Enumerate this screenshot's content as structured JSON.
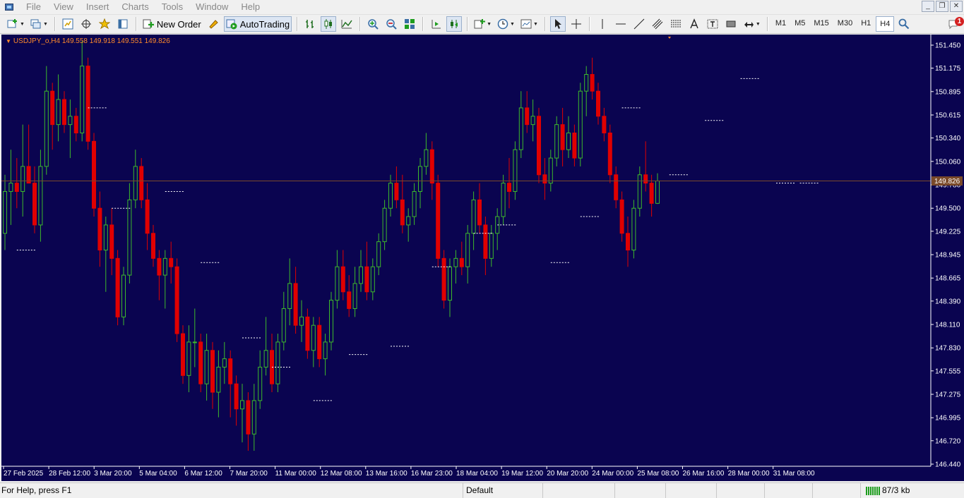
{
  "menubar": {
    "items": [
      "File",
      "View",
      "Insert",
      "Charts",
      "Tools",
      "Window",
      "Help"
    ]
  },
  "toolbar": {
    "new_order_label": "New Order",
    "autotrading_label": "AutoTrading",
    "timeframes": [
      "M1",
      "M5",
      "M15",
      "M30",
      "H1",
      "H4"
    ],
    "active_timeframe": "H4",
    "notifications_count": "1"
  },
  "chart": {
    "symbol_header": "USDJPY_o,H4  149.558 149.918 149.551 149.826",
    "background": "#0a0450",
    "bull_color": "#3dba2b",
    "bear_color": "#e00000",
    "current_price_label": "149.826",
    "current_price": 149.826,
    "price_scale": [
      "151.450",
      "151.175",
      "150.895",
      "150.615",
      "150.340",
      "150.060",
      "149.780",
      "149.500",
      "149.225",
      "148.945",
      "148.665",
      "148.390",
      "148.110",
      "147.830",
      "147.555",
      "147.275",
      "146.995",
      "146.720",
      "146.440"
    ],
    "time_scale": [
      "27 Feb 2025",
      "28 Feb 12:00",
      "3 Mar 20:00",
      "5 Mar 04:00",
      "6 Mar 12:00",
      "7 Mar 20:00",
      "11 Mar 00:00",
      "12 Mar 08:00",
      "13 Mar 16:00",
      "16 Mar 23:00",
      "18 Mar 04:00",
      "19 Mar 12:00",
      "20 Mar 20:00",
      "24 Mar 00:00",
      "25 Mar 08:00",
      "26 Mar 16:00",
      "28 Mar 00:00",
      "31 Mar 08:00"
    ]
  },
  "chart_data": {
    "type": "candlestick",
    "title": "USDJPY_o,H4",
    "ylim": [
      146.44,
      151.5
    ],
    "last_bar": {
      "open": 149.558,
      "high": 149.918,
      "low": 149.551,
      "close": 149.826
    },
    "series": [
      {
        "name": "USDJPY_o",
        "ohlc": [
          [
            149.2,
            149.9,
            149.0,
            149.7
          ],
          [
            149.7,
            150.2,
            149.3,
            149.8
          ],
          [
            149.8,
            150.1,
            149.5,
            149.7
          ],
          [
            149.7,
            150.5,
            149.4,
            150.0
          ],
          [
            150.0,
            150.5,
            149.8,
            149.8
          ],
          [
            149.8,
            150.0,
            149.2,
            149.3
          ],
          [
            149.3,
            150.2,
            149.1,
            150.0
          ],
          [
            150.0,
            151.2,
            149.9,
            150.9
          ],
          [
            150.9,
            151.0,
            150.2,
            150.5
          ],
          [
            150.5,
            151.1,
            150.3,
            150.8
          ],
          [
            150.8,
            150.9,
            150.4,
            150.5
          ],
          [
            150.5,
            150.8,
            150.1,
            150.6
          ],
          [
            150.6,
            150.7,
            150.3,
            150.4
          ],
          [
            150.4,
            151.5,
            150.3,
            151.2
          ],
          [
            151.2,
            151.3,
            150.2,
            150.3
          ],
          [
            150.3,
            150.4,
            149.4,
            149.5
          ],
          [
            149.5,
            149.7,
            148.8,
            149.0
          ],
          [
            149.0,
            149.4,
            148.5,
            149.3
          ],
          [
            149.3,
            149.5,
            148.7,
            148.9
          ],
          [
            148.9,
            149.0,
            148.1,
            148.2
          ],
          [
            148.2,
            148.8,
            148.1,
            148.7
          ],
          [
            148.7,
            149.8,
            148.6,
            149.6
          ],
          [
            149.6,
            150.2,
            149.5,
            150.0
          ],
          [
            150.0,
            150.1,
            149.5,
            149.6
          ],
          [
            149.6,
            149.8,
            149.0,
            149.2
          ],
          [
            149.2,
            149.3,
            148.8,
            148.9
          ],
          [
            148.9,
            149.0,
            148.4,
            148.7
          ],
          [
            148.7,
            149.0,
            148.3,
            148.9
          ],
          [
            148.9,
            149.1,
            148.6,
            148.8
          ],
          [
            148.8,
            148.9,
            147.9,
            148.0
          ],
          [
            148.0,
            148.1,
            147.4,
            147.5
          ],
          [
            147.5,
            148.1,
            147.3,
            147.9
          ],
          [
            147.9,
            148.3,
            147.6,
            147.9
          ],
          [
            147.9,
            148.0,
            147.3,
            147.4
          ],
          [
            147.4,
            148.0,
            147.2,
            147.8
          ],
          [
            147.8,
            147.9,
            147.1,
            147.3
          ],
          [
            147.3,
            147.8,
            147.0,
            147.6
          ],
          [
            147.6,
            147.9,
            147.4,
            147.7
          ],
          [
            147.7,
            147.8,
            147.0,
            147.4
          ],
          [
            147.4,
            147.5,
            146.9,
            147.1
          ],
          [
            147.1,
            147.4,
            146.7,
            147.2
          ],
          [
            147.2,
            147.3,
            146.6,
            146.8
          ],
          [
            146.8,
            147.4,
            146.6,
            147.2
          ],
          [
            147.2,
            147.8,
            147.1,
            147.6
          ],
          [
            147.6,
            148.2,
            147.5,
            147.8
          ],
          [
            147.8,
            148.0,
            147.3,
            147.4
          ],
          [
            147.4,
            148.0,
            147.3,
            147.9
          ],
          [
            147.9,
            148.5,
            147.8,
            148.3
          ],
          [
            148.3,
            148.9,
            148.1,
            148.6
          ],
          [
            148.6,
            148.8,
            148.0,
            148.1
          ],
          [
            148.1,
            148.4,
            147.9,
            148.2
          ],
          [
            148.2,
            148.3,
            147.7,
            147.8
          ],
          [
            147.8,
            148.2,
            147.6,
            148.1
          ],
          [
            148.1,
            148.2,
            147.6,
            147.7
          ],
          [
            147.7,
            148.0,
            147.5,
            147.9
          ],
          [
            147.9,
            148.5,
            147.8,
            148.4
          ],
          [
            148.4,
            149.0,
            148.3,
            148.8
          ],
          [
            148.8,
            149.0,
            148.4,
            148.5
          ],
          [
            148.5,
            148.7,
            148.2,
            148.3
          ],
          [
            148.3,
            148.8,
            148.2,
            148.6
          ],
          [
            148.6,
            149.0,
            148.5,
            148.8
          ],
          [
            148.8,
            149.1,
            148.4,
            148.5
          ],
          [
            148.5,
            148.9,
            148.4,
            148.8
          ],
          [
            148.8,
            149.2,
            148.7,
            149.1
          ],
          [
            149.1,
            149.6,
            149.0,
            149.5
          ],
          [
            149.5,
            149.9,
            149.4,
            149.8
          ],
          [
            149.8,
            150.0,
            149.5,
            149.6
          ],
          [
            149.6,
            149.9,
            149.2,
            149.3
          ],
          [
            149.3,
            149.5,
            149.1,
            149.4
          ],
          [
            149.4,
            149.8,
            149.3,
            149.7
          ],
          [
            149.7,
            150.1,
            149.5,
            150.0
          ],
          [
            150.0,
            150.4,
            149.9,
            150.2
          ],
          [
            150.2,
            150.3,
            149.6,
            149.8
          ],
          [
            149.8,
            149.9,
            148.8,
            148.9
          ],
          [
            148.9,
            149.0,
            148.3,
            148.4
          ],
          [
            148.4,
            148.9,
            148.2,
            148.8
          ],
          [
            148.8,
            149.0,
            148.6,
            148.9
          ],
          [
            148.9,
            149.1,
            148.7,
            148.8
          ],
          [
            148.8,
            149.3,
            148.6,
            149.2
          ],
          [
            149.2,
            149.7,
            149.0,
            149.6
          ],
          [
            149.6,
            149.8,
            149.2,
            149.3
          ],
          [
            149.3,
            149.4,
            148.7,
            148.9
          ],
          [
            148.9,
            149.3,
            148.8,
            149.2
          ],
          [
            149.2,
            149.5,
            149.0,
            149.4
          ],
          [
            149.4,
            149.9,
            149.3,
            149.8
          ],
          [
            149.8,
            150.1,
            149.5,
            149.7
          ],
          [
            149.7,
            150.3,
            149.6,
            150.2
          ],
          [
            150.2,
            150.9,
            150.1,
            150.7
          ],
          [
            150.7,
            150.9,
            150.4,
            150.5
          ],
          [
            150.5,
            150.8,
            150.3,
            150.6
          ],
          [
            150.6,
            150.7,
            149.8,
            149.9
          ],
          [
            149.9,
            150.1,
            149.6,
            149.8
          ],
          [
            149.8,
            150.2,
            149.7,
            150.1
          ],
          [
            150.1,
            150.6,
            150.0,
            150.5
          ],
          [
            150.5,
            150.7,
            150.0,
            150.2
          ],
          [
            150.2,
            150.6,
            150.1,
            150.4
          ],
          [
            150.4,
            150.5,
            150.0,
            150.1
          ],
          [
            150.1,
            151.0,
            150.0,
            150.9
          ],
          [
            150.9,
            151.2,
            150.6,
            151.1
          ],
          [
            151.1,
            151.3,
            150.8,
            150.9
          ],
          [
            150.9,
            151.0,
            150.5,
            150.6
          ],
          [
            150.6,
            150.7,
            150.3,
            150.4
          ],
          [
            150.4,
            150.5,
            149.8,
            149.9
          ],
          [
            149.9,
            150.0,
            149.5,
            149.6
          ],
          [
            149.6,
            149.7,
            149.1,
            149.2
          ],
          [
            149.2,
            149.4,
            148.8,
            149.0
          ],
          [
            149.0,
            149.6,
            148.9,
            149.5
          ],
          [
            149.5,
            150.0,
            149.4,
            149.9
          ],
          [
            149.9,
            150.3,
            149.7,
            149.8
          ],
          [
            149.8,
            149.9,
            149.4,
            149.558
          ],
          [
            149.558,
            149.918,
            149.551,
            149.826
          ]
        ]
      }
    ],
    "x_labels": [
      "27 Feb 2025",
      "28 Feb 12:00",
      "3 Mar 20:00",
      "5 Mar 04:00",
      "6 Mar 12:00",
      "7 Mar 20:00",
      "11 Mar 00:00",
      "12 Mar 08:00",
      "13 Mar 16:00",
      "16 Mar 23:00",
      "18 Mar 04:00",
      "19 Mar 12:00",
      "20 Mar 20:00",
      "24 Mar 00:00",
      "25 Mar 08:00",
      "26 Mar 16:00",
      "28 Mar 00:00",
      "31 Mar 08:00"
    ],
    "y_ticks": [
      151.45,
      151.175,
      150.895,
      150.615,
      150.34,
      150.06,
      149.78,
      149.5,
      149.225,
      148.945,
      148.665,
      148.39,
      148.11,
      147.83,
      147.555,
      147.275,
      146.995,
      146.72,
      146.44
    ],
    "grid": false
  },
  "statusbar": {
    "help_text": "For Help, press F1",
    "profile": "Default",
    "connection": "87/3 kb"
  }
}
